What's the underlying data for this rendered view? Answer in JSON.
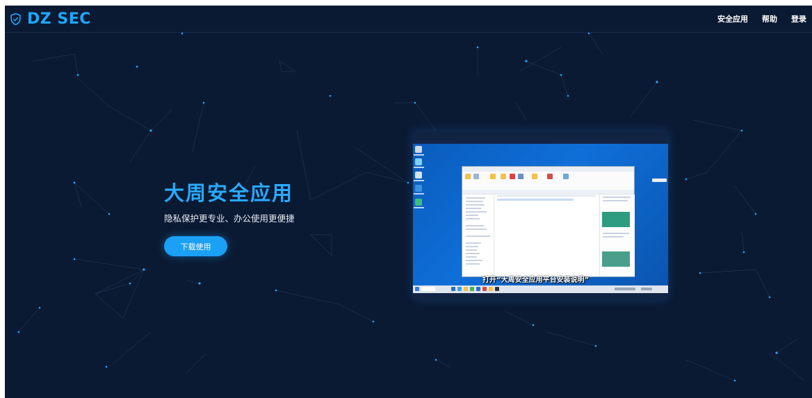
{
  "brand": {
    "name": "DZ SEC",
    "logo_icon": "shield-check-icon",
    "accent": "#1ea7ff"
  },
  "nav": {
    "items": [
      "安全应用",
      "帮助",
      "登录"
    ]
  },
  "hero": {
    "title": "大周安全应用",
    "subtitle": "隐私保护更专业、办公使用更便捷",
    "cta_label": "下载使用"
  },
  "preview": {
    "caption": "打开“大周安全应用平台安装说明”"
  },
  "colors": {
    "background": "#0b1a33",
    "accent": "#1ea7ff",
    "button": "#1aa0f5"
  }
}
